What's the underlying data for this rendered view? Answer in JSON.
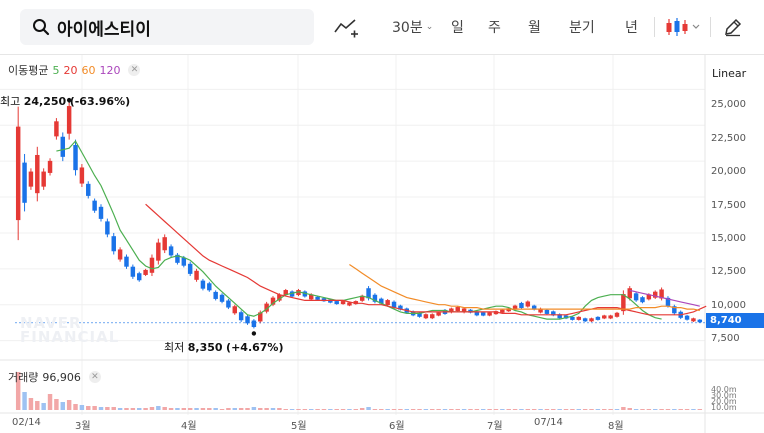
{
  "search": {
    "value": "아이에스티이",
    "icon": "search-icon"
  },
  "toolbar": {
    "interval_label": "30분",
    "periods": [
      {
        "label": "일",
        "active": true
      },
      {
        "label": "주",
        "active": false
      },
      {
        "label": "월",
        "active": false
      },
      {
        "label": "분기",
        "active": false
      },
      {
        "label": "년",
        "active": false
      }
    ],
    "icons": [
      "drawing-tool-icon",
      "candle-type-icon",
      "chevron-down-icon",
      "pen-icon"
    ]
  },
  "ma_legend": {
    "title": "이동평균",
    "periods": [
      {
        "label": "5",
        "color": "#4caf50"
      },
      {
        "label": "20",
        "color": "#e53935"
      },
      {
        "label": "60",
        "color": "#f28c28"
      },
      {
        "label": "120",
        "color": "#ab47bc"
      }
    ]
  },
  "scale_mode": "Linear",
  "price_axis": [
    "25,000",
    "22,500",
    "20,000",
    "17,500",
    "15,000",
    "12,500",
    "10,000",
    "7,500"
  ],
  "last_price": "8,740",
  "high_annotation": {
    "label": "최고",
    "value": "24,250",
    "change": "(-63.96%)"
  },
  "low_annotation": {
    "label": "최저",
    "value": "8,350",
    "change": "(+4.67%)"
  },
  "watermark": {
    "line1": "NAVER",
    "line2": "FINANCIAL"
  },
  "volume_legend": {
    "title": "거래량",
    "value": "96,906"
  },
  "volume_axis": [
    "40.0m",
    "30.0m",
    "20.0m",
    "10.0m"
  ],
  "date_axis": [
    "02/14",
    "3월",
    "4월",
    "5월",
    "6월",
    "7월",
    "07/14",
    "8월"
  ],
  "colors": {
    "up": "#e53935",
    "down": "#1a73e8",
    "accent": "#1a73e8"
  },
  "chart_data": {
    "type": "candlestick",
    "price_range": [
      6500,
      26000
    ],
    "points": [
      [
        23800,
        14500
      ],
      [
        20500,
        16500
      ],
      [
        18000,
        19500
      ],
      [
        21000,
        17200
      ],
      [
        19500,
        18000
      ],
      [
        20200,
        19000
      ],
      [
        23000,
        21500
      ],
      [
        22000,
        20000
      ],
      [
        24250,
        21500
      ],
      [
        21500,
        19000
      ],
      [
        19800,
        18200
      ],
      [
        18600,
        17400
      ],
      [
        17400,
        16400
      ],
      [
        17000,
        15800
      ],
      [
        16000,
        14700
      ],
      [
        15000,
        13500
      ],
      [
        14000,
        13000
      ],
      [
        13500,
        12500
      ],
      [
        12800,
        11800
      ],
      [
        12300,
        11600
      ],
      [
        12500,
        12000
      ],
      [
        13500,
        12000
      ],
      [
        14600,
        12800
      ],
      [
        14900,
        13600
      ],
      [
        14200,
        13300
      ],
      [
        13600,
        12800
      ],
      [
        13400,
        12600
      ],
      [
        13000,
        12000
      ],
      [
        12500,
        11600
      ],
      [
        11800,
        11000
      ],
      [
        11600,
        10900
      ],
      [
        11000,
        10300
      ],
      [
        10800,
        10100
      ],
      [
        10400,
        9700
      ],
      [
        10000,
        9300
      ],
      [
        9600,
        8800
      ],
      [
        9300,
        8600
      ],
      [
        9000,
        8350
      ],
      [
        9600,
        8700
      ],
      [
        10200,
        9400
      ],
      [
        10600,
        9900
      ],
      [
        10800,
        10200
      ],
      [
        11100,
        10600
      ],
      [
        11000,
        10500
      ],
      [
        11100,
        10600
      ],
      [
        11000,
        10500
      ],
      [
        10800,
        10300
      ],
      [
        10600,
        10300
      ],
      [
        10500,
        10200
      ],
      [
        10400,
        10100
      ],
      [
        10300,
        10000
      ],
      [
        10300,
        10000
      ],
      [
        10200,
        9900
      ],
      [
        10300,
        10000
      ],
      [
        10700,
        10200
      ],
      [
        11300,
        10300
      ],
      [
        10800,
        10100
      ],
      [
        10500,
        10000
      ],
      [
        10400,
        9900
      ],
      [
        10300,
        9700
      ],
      [
        10000,
        9600
      ],
      [
        9800,
        9400
      ],
      [
        9600,
        9200
      ],
      [
        9500,
        9100
      ],
      [
        9400,
        9000
      ],
      [
        9400,
        9000
      ],
      [
        9500,
        9200
      ],
      [
        9700,
        9300
      ],
      [
        9800,
        9400
      ],
      [
        9900,
        9500
      ],
      [
        9800,
        9400
      ],
      [
        9700,
        9400
      ],
      [
        9600,
        9200
      ],
      [
        9500,
        9200
      ],
      [
        9500,
        9200
      ],
      [
        9600,
        9300
      ],
      [
        9700,
        9400
      ],
      [
        9800,
        9500
      ],
      [
        10000,
        9600
      ],
      [
        10200,
        9700
      ],
      [
        10300,
        9800
      ],
      [
        10000,
        9600
      ],
      [
        9800,
        9400
      ],
      [
        9700,
        9300
      ],
      [
        9600,
        9200
      ],
      [
        9400,
        9000
      ],
      [
        9300,
        9000
      ],
      [
        9200,
        8900
      ],
      [
        9200,
        8900
      ],
      [
        9100,
        8800
      ],
      [
        9100,
        8800
      ],
      [
        9200,
        8900
      ],
      [
        9300,
        9000
      ],
      [
        9300,
        9000
      ],
      [
        9500,
        9100
      ],
      [
        11000,
        9300
      ],
      [
        11300,
        10300
      ],
      [
        10900,
        10200
      ],
      [
        10600,
        10100
      ],
      [
        10800,
        10300
      ],
      [
        11000,
        10400
      ],
      [
        11200,
        10300
      ],
      [
        10600,
        9800
      ],
      [
        10000,
        9300
      ],
      [
        9600,
        9000
      ],
      [
        9300,
        8900
      ],
      [
        9100,
        8800
      ],
      [
        9000,
        8740
      ]
    ],
    "ma": [
      {
        "name": "5",
        "color": "#4caf50",
        "start": 6,
        "values": [
          20700,
          20800,
          20900,
          21400,
          20600,
          19800,
          19000,
          18300,
          17300,
          16300,
          15200,
          14500,
          13800,
          13100,
          12700,
          12500,
          12600,
          13100,
          13300,
          13400,
          13300,
          13100,
          12700,
          12300,
          11800,
          11300,
          10900,
          10500,
          10100,
          9700,
          9300,
          9200,
          9400,
          9700,
          10100,
          10400,
          10700,
          10800,
          10900,
          10800,
          10700,
          10600,
          10500,
          10400,
          10300,
          10300,
          10400,
          10500,
          10600,
          10500,
          10300,
          10100,
          9900,
          9700,
          9500,
          9400,
          9400,
          9400,
          9500,
          9600,
          9600,
          9600,
          9500,
          9500,
          9500,
          9500,
          9600,
          9700,
          9800,
          9900,
          9900,
          9800,
          9600,
          9500,
          9300,
          9200,
          9100,
          9000,
          9000,
          9000,
          9100,
          9200,
          9400,
          9900,
          10300,
          10500,
          10600,
          10700,
          10700,
          10700,
          10400,
          10000,
          9600,
          9300,
          9100,
          9000
        ]
      },
      {
        "name": "20",
        "color": "#e53935",
        "start": 20,
        "values": [
          17000,
          16600,
          16200,
          15800,
          15400,
          15000,
          14600,
          14200,
          13800,
          13400,
          13100,
          12900,
          12700,
          12500,
          12300,
          12100,
          11900,
          11600,
          11300,
          11100,
          10900,
          10700,
          10600,
          10500,
          10400,
          10300,
          10300,
          10300,
          10300,
          10300,
          10300,
          10300,
          10200,
          10100,
          10100,
          10000,
          10000,
          10000,
          9900,
          9800,
          9700,
          9600,
          9500,
          9500,
          9500,
          9500,
          9500,
          9500,
          9500,
          9500,
          9500,
          9500,
          9500,
          9500,
          9500,
          9500,
          9400,
          9400,
          9400,
          9300,
          9300,
          9300,
          9300,
          9300,
          9300,
          9300,
          9300,
          9400,
          9500,
          9600,
          9700,
          9800,
          9800,
          9800,
          9800,
          9700,
          9600,
          9500,
          9400,
          9300,
          9300,
          9300,
          9300,
          9300,
          9300,
          9400,
          9500,
          9700,
          9900
        ]
      },
      {
        "name": "60",
        "color": "#f28c28",
        "start": 52,
        "values": [
          12800,
          12500,
          12200,
          11900,
          11600,
          11300,
          11100,
          10900,
          10700,
          10500,
          10400,
          10300,
          10200,
          10100,
          10000,
          10000,
          9900,
          9900,
          9800,
          9800,
          9800,
          9700,
          9700,
          9700,
          9700,
          9700,
          9700,
          9700,
          9700,
          9700,
          9700,
          9700,
          9700,
          9700,
          9700,
          9700,
          9700,
          9700,
          9700,
          9700,
          9700,
          9700,
          9700,
          9700,
          9700,
          9800,
          9800,
          9800,
          9800,
          9900,
          9900,
          9800,
          9800,
          9700,
          9700,
          9600
        ]
      },
      {
        "name": "120",
        "color": "#ab47bc",
        "start": 96,
        "values": [
          11000,
          10900,
          10800,
          10700,
          10600,
          10500,
          10400,
          10300,
          10200,
          10100,
          10000,
          9900
        ]
      }
    ],
    "volume": [
      38,
      18,
      12,
      9,
      7,
      16,
      11,
      8,
      10,
      6,
      5,
      4,
      4,
      3,
      3,
      3,
      2,
      2,
      2,
      2,
      2,
      3,
      4,
      3,
      2,
      2,
      2,
      2,
      2,
      2,
      2,
      2,
      1,
      2,
      2,
      2,
      2,
      3,
      2,
      2,
      2,
      2,
      1,
      1,
      1,
      1,
      1,
      1,
      1,
      1,
      1,
      1,
      1,
      1,
      2,
      3,
      1,
      1,
      1,
      1,
      1,
      1,
      1,
      1,
      1,
      1,
      1,
      1,
      1,
      1,
      1,
      1,
      1,
      1,
      1,
      1,
      1,
      1,
      1,
      1,
      1,
      1,
      1,
      1,
      1,
      1,
      1,
      1,
      1,
      1,
      1,
      1,
      1,
      1,
      1,
      3,
      2,
      1,
      1,
      1,
      1,
      1,
      1,
      1,
      1,
      1,
      1,
      1
    ],
    "volume_range": [
      0,
      40
    ]
  }
}
